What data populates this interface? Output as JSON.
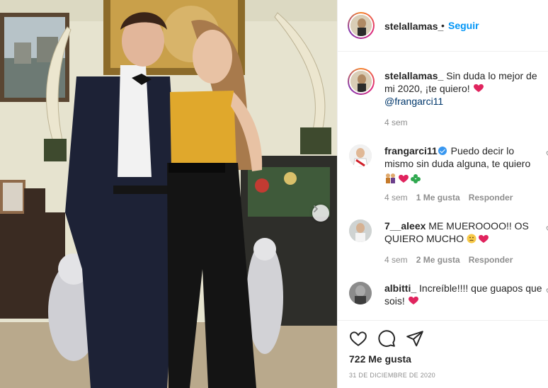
{
  "post": {
    "author": "stelallamas_",
    "follow_separator": "•",
    "follow_label": "Seguir",
    "caption_text": "Sin duda lo mejor de mi 2020, ¡te quiero!",
    "caption_mention": "@frangarci11",
    "caption_time": "4 sem",
    "likes": "722 Me gusta",
    "date": "31 DE DICIEMBRE DE 2020"
  },
  "comments": [
    {
      "user": "frangarci11",
      "verified": true,
      "text": "Puedo decir lo mismo sin duda alguna, te quiero",
      "time": "4 sem",
      "likes": "1 Me gusta",
      "reply": "Responder"
    },
    {
      "user": "7__aleex",
      "verified": false,
      "text": "ME MUEROOOO!! OS QUIERO MUCHO",
      "time": "4 sem",
      "likes": "2 Me gusta",
      "reply": "Responder"
    },
    {
      "user": "albitti_",
      "verified": false,
      "text": "Increíble!!!! que guapos que sois!"
    }
  ],
  "icons": {
    "like": "heart-outline-icon",
    "comment": "speech-bubble-icon",
    "share": "paper-plane-icon",
    "next": "chevron-right-icon"
  },
  "colors": {
    "link_blue": "#0095f6",
    "mention_blue": "#00376b",
    "secondary_gray": "#8e8e8e",
    "heart_red": "#e0245e",
    "divider": "#efefef"
  }
}
